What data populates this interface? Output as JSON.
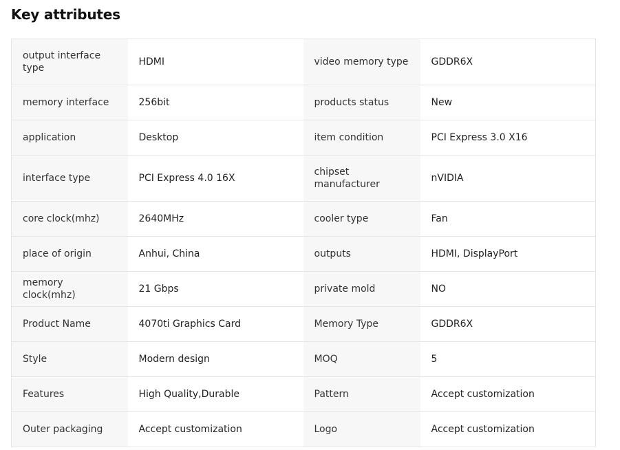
{
  "section": {
    "title": "Key attributes"
  },
  "attributes": [
    {
      "left_key": "output interface type",
      "left_value": "HDMI",
      "right_key": "video memory type",
      "right_value": "GDDR6X"
    },
    {
      "left_key": "memory interface",
      "left_value": "256bit",
      "right_key": "products status",
      "right_value": "New"
    },
    {
      "left_key": "application",
      "left_value": "Desktop",
      "right_key": "item condition",
      "right_value": "PCI Express 3.0 X16"
    },
    {
      "left_key": "interface type",
      "left_value": "PCI Express 4.0 16X",
      "right_key": "chipset manufacturer",
      "right_value": "nVIDIA"
    },
    {
      "left_key": "core clock(mhz)",
      "left_value": "2640MHz",
      "right_key": "cooler type",
      "right_value": "Fan"
    },
    {
      "left_key": "place of origin",
      "left_value": "Anhui, China",
      "right_key": "outputs",
      "right_value": "HDMI, DisplayPort"
    },
    {
      "left_key": "memory clock(mhz)",
      "left_value": "21 Gbps",
      "right_key": "private mold",
      "right_value": "NO"
    },
    {
      "left_key": "Product Name",
      "left_value": "4070ti Graphics Card",
      "right_key": "Memory Type",
      "right_value": "GDDR6X"
    },
    {
      "left_key": "Style",
      "left_value": "Modern design",
      "right_key": "MOQ",
      "right_value": "5"
    },
    {
      "left_key": "Features",
      "left_value": "High Quality,Durable",
      "right_key": "Pattern",
      "right_value": "Accept customization"
    },
    {
      "left_key": "Outer packaging",
      "left_value": "Accept customization",
      "right_key": "Logo",
      "right_value": "Accept customization"
    }
  ]
}
